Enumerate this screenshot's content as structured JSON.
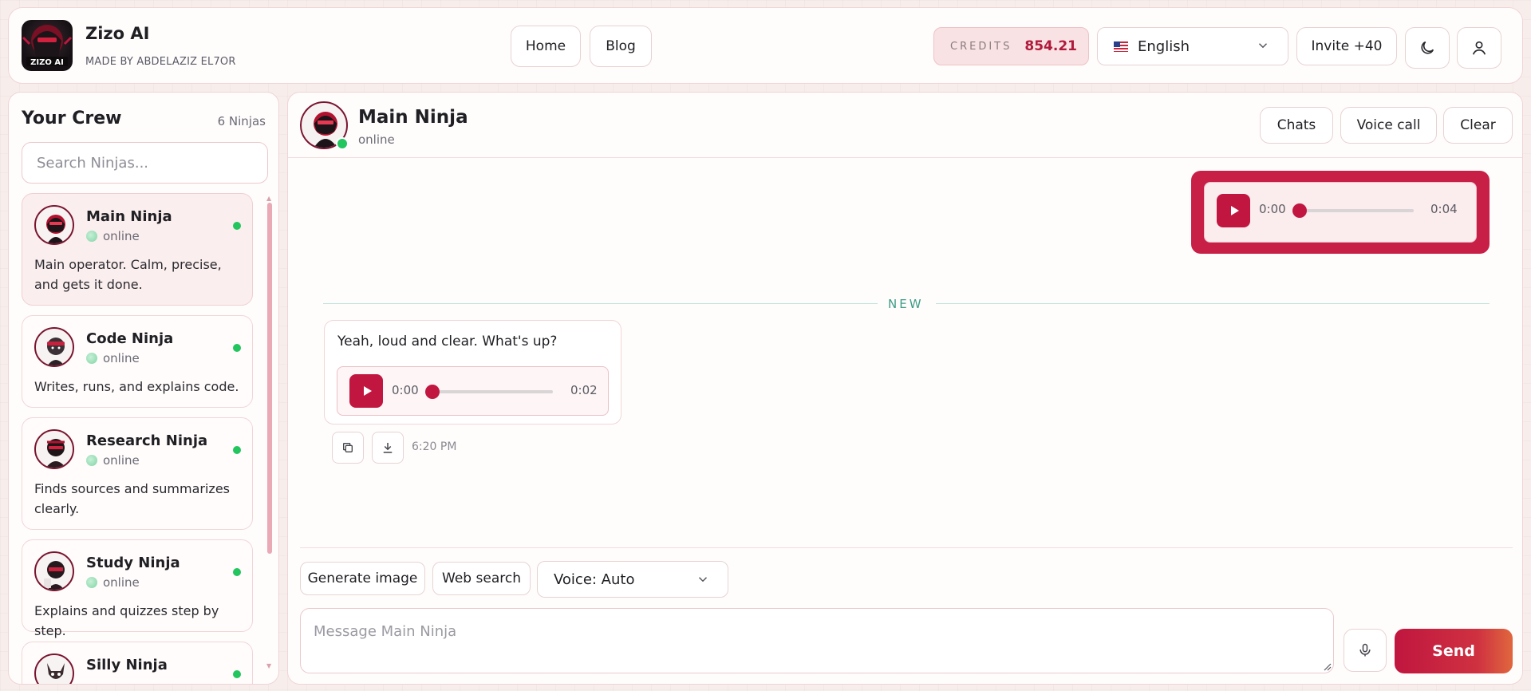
{
  "brand": {
    "title": "Zizo AI",
    "subtitle": "MADE BY ABDELAZIZ EL7OR",
    "logo_text": "ZIZO AI"
  },
  "nav": {
    "home": "Home",
    "blog": "Blog"
  },
  "credits": {
    "label": "CREDITS",
    "value": "854.21"
  },
  "language": {
    "selected": "English",
    "flag": "us-flag-icon"
  },
  "invite": "Invite +40",
  "sidebar": {
    "title": "Your Crew",
    "count": "6 Ninjas",
    "search_placeholder": "Search Ninjas...",
    "items": [
      {
        "name": "Main Ninja",
        "status": "online",
        "desc": "Main operator. Calm, precise, and gets it done."
      },
      {
        "name": "Code Ninja",
        "status": "online",
        "desc": "Writes, runs, and explains code."
      },
      {
        "name": "Research Ninja",
        "status": "online",
        "desc": "Finds sources and summarizes clearly."
      },
      {
        "name": "Study Ninja",
        "status": "online",
        "desc": "Explains and quizzes step by step."
      },
      {
        "name": "Silly Ninja",
        "status": "online",
        "desc": ""
      }
    ]
  },
  "chat": {
    "name": "Main Ninja",
    "status": "online",
    "buttons": {
      "chats": "Chats",
      "voice_call": "Voice call",
      "clear": "Clear"
    },
    "outgoing_audio": {
      "current": "0:00",
      "duration": "0:04",
      "progress": 0
    },
    "divider": "NEW",
    "incoming": {
      "text": "Yeah, loud and clear. What's up?",
      "audio": {
        "current": "0:00",
        "duration": "0:02",
        "progress": 0
      },
      "time": "6:20 PM"
    }
  },
  "composer": {
    "generate_image": "Generate image",
    "web_search": "Web search",
    "voice": "Voice: Auto",
    "placeholder": "Message Main Ninja",
    "send": "Send"
  },
  "colors": {
    "accent": "#c0163f",
    "online": "#22c55e"
  }
}
